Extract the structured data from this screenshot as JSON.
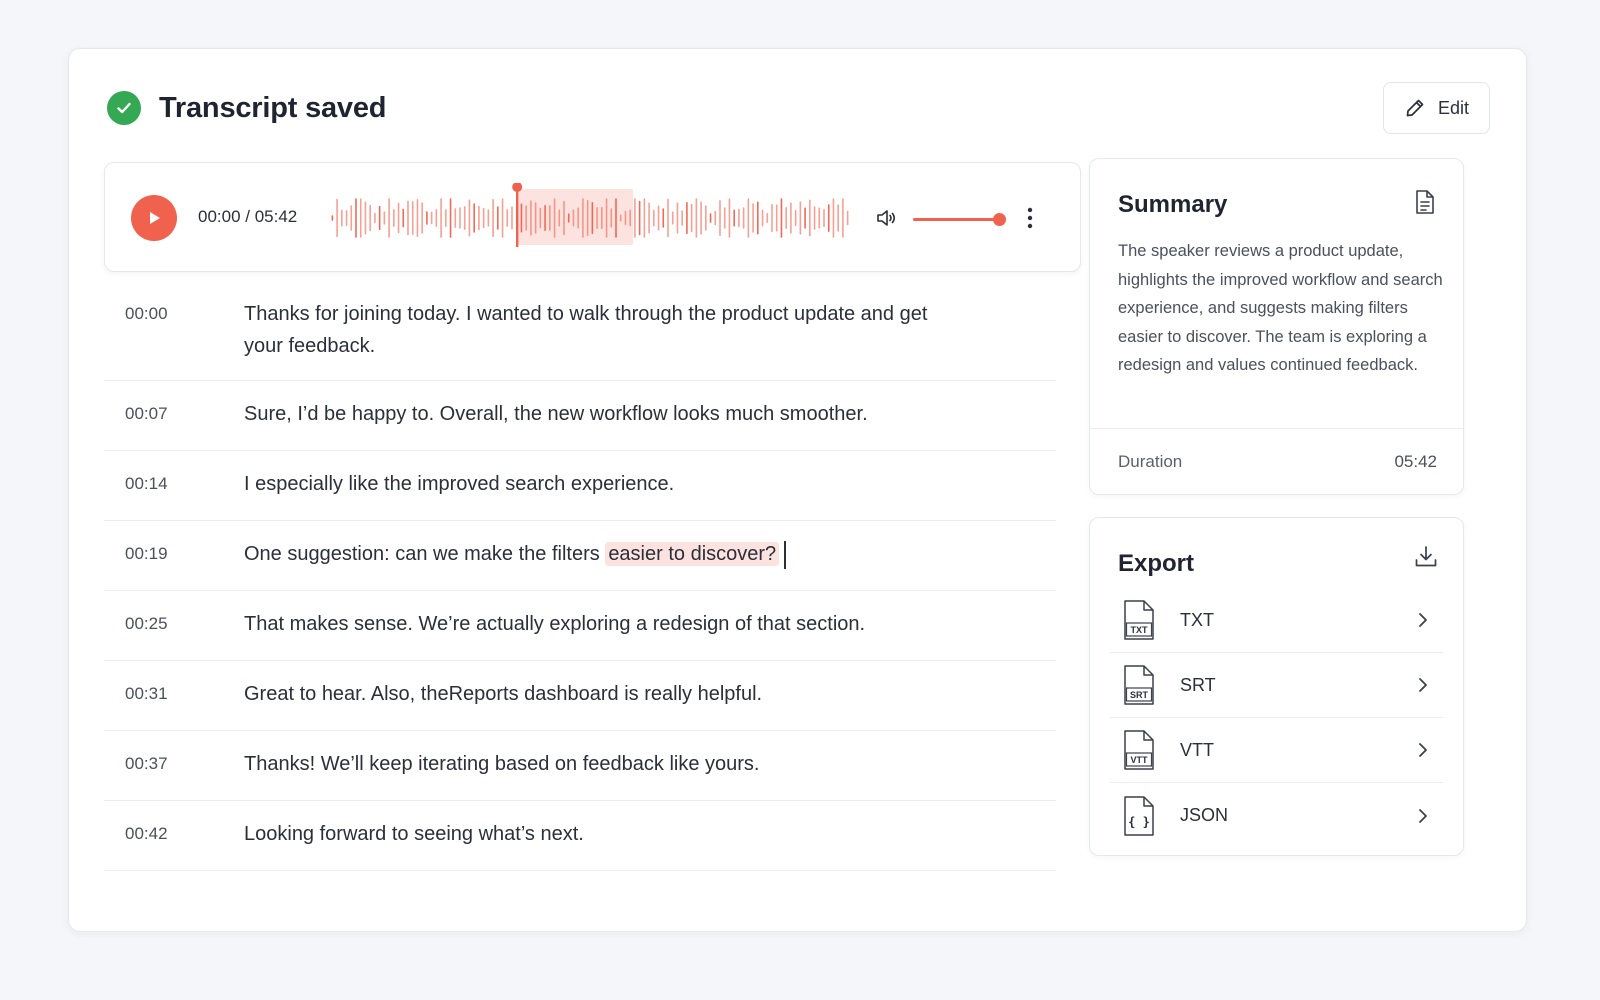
{
  "header": {
    "title": "Transcript saved",
    "edit_label": "Edit"
  },
  "player": {
    "time_readout": "00:00 / 05:42",
    "progress_fraction": 0.36,
    "volume_fraction": 0.93
  },
  "transcript": [
    {
      "ts": "00:00",
      "text": "Thanks for joining today. I wanted to walk through the product update and get your feedback."
    },
    {
      "ts": "00:07",
      "text": "Sure, I’d be happy to. Overall, the new workflow looks much smoother."
    },
    {
      "ts": "00:14",
      "text": "I especially like the improved search experience."
    },
    {
      "ts": "00:19",
      "text_before": "One suggestion: can we make the filters ",
      "highlight": "easier to discover?"
    },
    {
      "ts": "00:25",
      "text": "That makes sense. We’re actually exploring a redesign of that section."
    },
    {
      "ts": "00:31",
      "text": "Great to hear. Also, theReports dashboard is really helpful."
    },
    {
      "ts": "00:37",
      "text": "Thanks! We’ll keep iterating based on feedback like yours."
    },
    {
      "ts": "00:42",
      "text": "Looking forward to seeing what’s next."
    }
  ],
  "summary": {
    "title": "Summary",
    "text": "The speaker reviews a product update, highlights the improved workflow and search experience, and suggests making filters easier to discover. The team is exploring a redesign and values continued feedback.",
    "duration_label": "Duration",
    "duration_value": "05:42"
  },
  "export": {
    "title": "Export",
    "items": [
      {
        "label": "TXT",
        "icon_text": "TXT"
      },
      {
        "label": "SRT",
        "icon_text": "SRT"
      },
      {
        "label": "VTT",
        "icon_text": "VTT"
      },
      {
        "label": "JSON",
        "icon_text": "{ }"
      }
    ]
  },
  "colors": {
    "accent": "#f0624d",
    "success": "#34a853",
    "highlight": "#fde3e0"
  },
  "icons": [
    "check-circle-icon",
    "pencil-icon",
    "play-icon",
    "volume-icon",
    "more-vertical-icon",
    "document-icon",
    "download-icon",
    "file-icon",
    "chevron-right-icon"
  ]
}
